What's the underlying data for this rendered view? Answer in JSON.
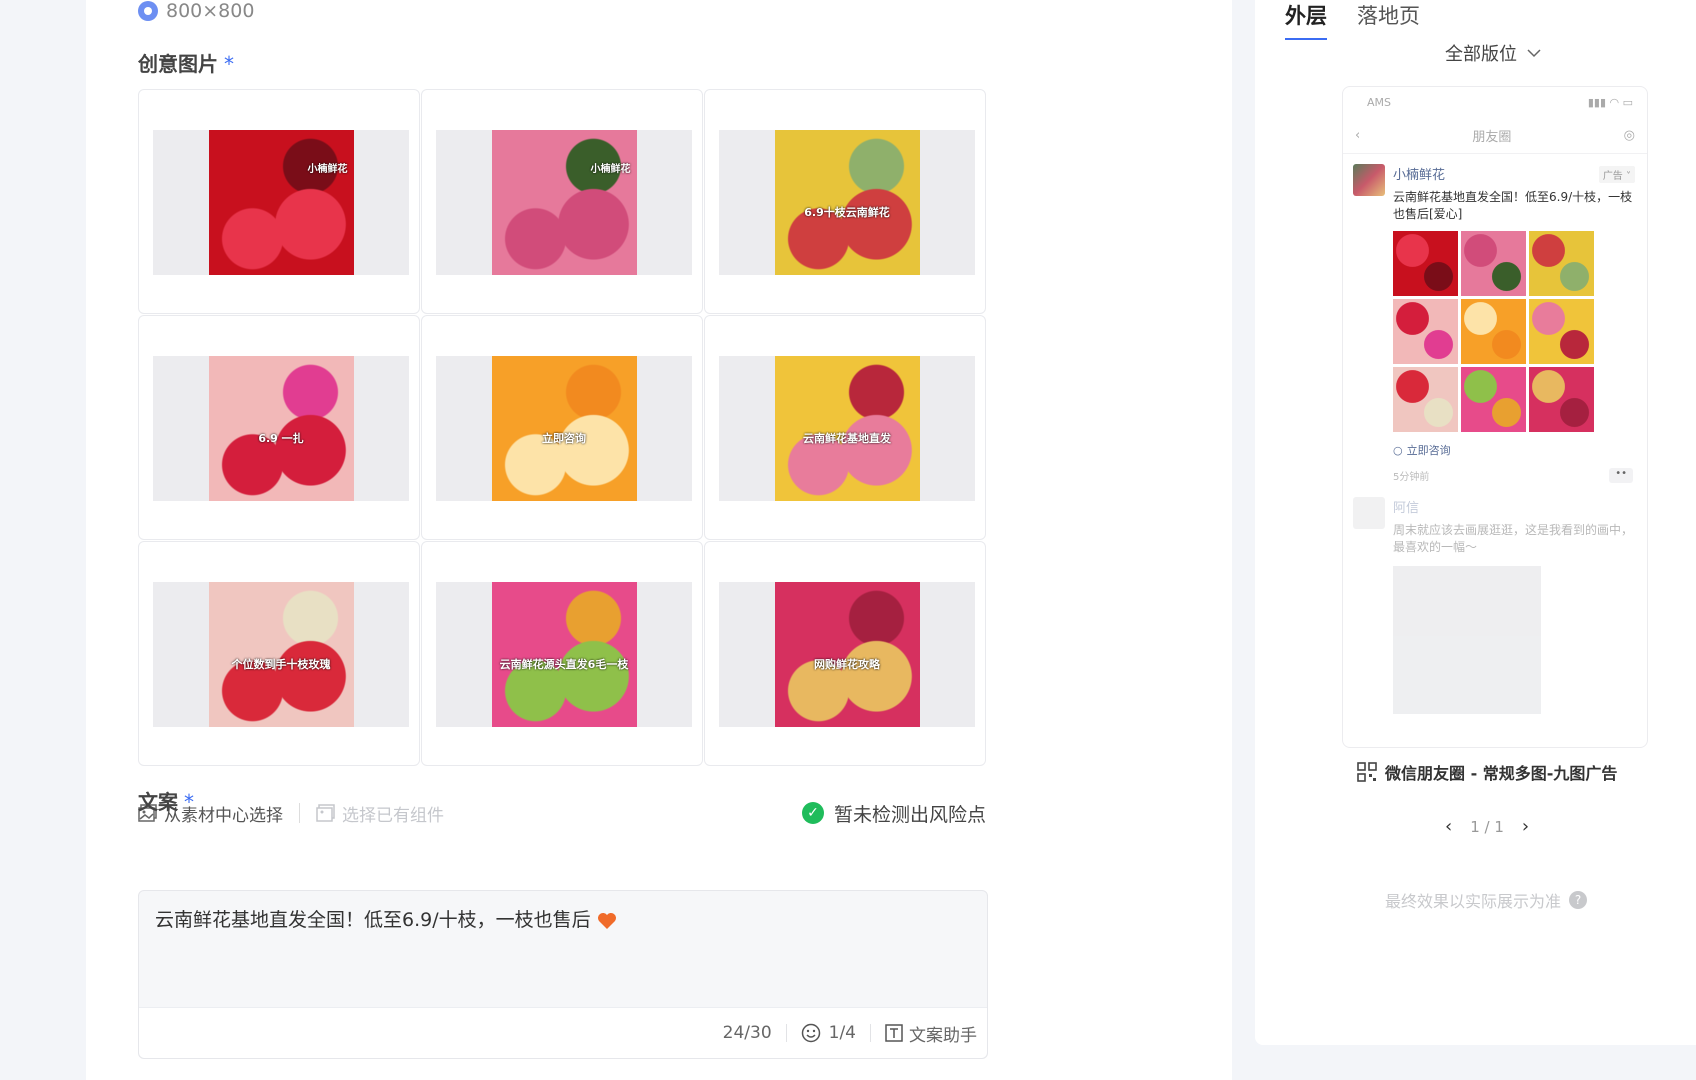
{
  "form": {
    "size_option": "800×800",
    "images_label": "创意图片",
    "required_mark": "*",
    "images": [
      {
        "caption": "",
        "corner": "小楠鲜花",
        "colors": [
          "#c8101e",
          "#e8344b",
          "#7a0d18"
        ]
      },
      {
        "caption": "",
        "corner": "小楠鲜花",
        "colors": [
          "#e6799b",
          "#d14c7a",
          "#3a5e2a"
        ]
      },
      {
        "caption": "6.9十枝云南鲜花",
        "corner": "",
        "colors": [
          "#e7c43a",
          "#cf3f3f",
          "#8fb06b"
        ]
      },
      {
        "caption": "6.9 一扎",
        "corner": "",
        "colors": [
          "#f2b8b8",
          "#d41e3c",
          "#e13d91"
        ]
      },
      {
        "caption": "立即咨询",
        "corner": "",
        "colors": [
          "#f7a028",
          "#fde3a8",
          "#f28a1f"
        ]
      },
      {
        "caption": "云南鲜花基地直发",
        "corner": "",
        "colors": [
          "#f0c43a",
          "#e87c9b",
          "#b8273b"
        ]
      },
      {
        "caption": "个位数到手十枝玫瑰",
        "corner": "",
        "colors": [
          "#f0c6c0",
          "#d9293a",
          "#e8e0c4"
        ]
      },
      {
        "caption": "云南鲜花源头直发6毛一枝",
        "corner": "",
        "colors": [
          "#e74b8a",
          "#8fc04a",
          "#e8a030"
        ]
      },
      {
        "caption": "网购鲜花攻略",
        "corner": "",
        "colors": [
          "#d6305f",
          "#e8b860",
          "#a52040"
        ]
      }
    ],
    "asset_center": "从素材中心选择",
    "existing_component": "选择已有组件",
    "risk_status": "暂未检测出风险点",
    "copy_label": "文案",
    "copy_text": "云南鲜花基地直发全国！低至6.9/十枝，一枝也售后",
    "char_count": "24/30",
    "emoji_count": "1/4",
    "copy_assistant": "文案助手"
  },
  "preview": {
    "tabs": [
      "外层",
      "落地页"
    ],
    "placement": "全部版位",
    "status_carrier": "AMS",
    "nav_title": "朋友圈",
    "post": {
      "name": "小楠鲜花",
      "ad_tag": "广告",
      "text": "云南鲜花基地直发全国！低至6.9/十枝，一枝也售后[爱心]",
      "consult": "立即咨询",
      "time": "5分钟前"
    },
    "post2": {
      "name": "阿信",
      "text": "周末就应该去画展逛逛，这是我看到的画中，最喜欢的一幅～"
    },
    "ad_type": "微信朋友圈 - 常规多图-九图广告",
    "pager": "1 / 1",
    "note": "最终效果以实际展示为准"
  },
  "colors": {
    "accent": "#3b6cf3",
    "success": "#1fbc5b"
  }
}
